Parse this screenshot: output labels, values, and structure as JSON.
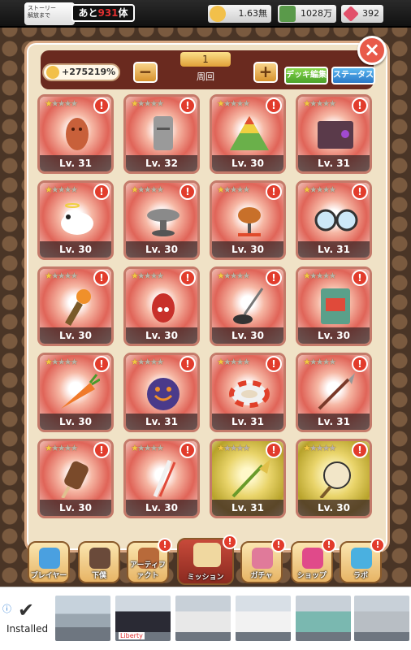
{
  "topbar": {
    "story_label": "ストーリー\n解放まで",
    "story_prefix": "あと",
    "story_count": "931",
    "story_suffix": "体",
    "coins": "1.63無",
    "medals": "1028万",
    "gems": "392"
  },
  "header": {
    "boost": "+275219%",
    "page_number": "1",
    "page_label": "周回",
    "minus": "−",
    "plus": "+",
    "deck_edit": "デッキ編集",
    "status": "ステータス"
  },
  "close_label": "×",
  "alert_mark": "!",
  "cards": [
    {
      "level": "Lv. 31",
      "stars": 1,
      "gold": false,
      "art": "clay-figure"
    },
    {
      "level": "Lv. 32",
      "stars": 1,
      "gold": false,
      "art": "moai"
    },
    {
      "level": "Lv. 30",
      "stars": 1,
      "gold": false,
      "art": "pyramid"
    },
    {
      "level": "Lv. 31",
      "stars": 1,
      "gold": false,
      "art": "book"
    },
    {
      "level": "Lv. 30",
      "stars": 1,
      "gold": false,
      "art": "panda"
    },
    {
      "level": "Lv. 30",
      "stars": 1,
      "gold": false,
      "art": "bowl"
    },
    {
      "level": "Lv. 30",
      "stars": 1,
      "gold": false,
      "art": "roast"
    },
    {
      "level": "Lv. 31",
      "stars": 1,
      "gold": false,
      "art": "glasses"
    },
    {
      "level": "Lv. 30",
      "stars": 1,
      "gold": false,
      "art": "torch"
    },
    {
      "level": "Lv. 30",
      "stars": 1,
      "gold": false,
      "art": "lantern"
    },
    {
      "level": "Lv. 30",
      "stars": 1,
      "gold": false,
      "art": "plunger"
    },
    {
      "level": "Lv. 30",
      "stars": 1,
      "gold": false,
      "art": "card"
    },
    {
      "level": "Lv. 30",
      "stars": 1,
      "gold": false,
      "art": "carrot"
    },
    {
      "level": "Lv. 31",
      "stars": 1,
      "gold": false,
      "art": "bomb"
    },
    {
      "level": "Lv. 31",
      "stars": 1,
      "gold": false,
      "art": "ring"
    },
    {
      "level": "Lv. 31",
      "stars": 1,
      "gold": false,
      "art": "spear"
    },
    {
      "level": "Lv. 30",
      "stars": 1,
      "gold": false,
      "art": "popsicle"
    },
    {
      "level": "Lv. 30",
      "stars": 1,
      "gold": false,
      "art": "chopsticks"
    },
    {
      "level": "Lv. 31",
      "stars": 1,
      "gold": true,
      "art": "broom"
    },
    {
      "level": "Lv. 30",
      "stars": 1,
      "gold": true,
      "art": "glove"
    }
  ],
  "nav": [
    {
      "label": "プレイヤー",
      "alert": false,
      "icon_color": "#4aa0e0"
    },
    {
      "label": "下僕",
      "alert": false,
      "icon_color": "#6a4a3a"
    },
    {
      "label": "アーティファクト",
      "alert": true,
      "icon_color": "#b86a3a"
    },
    {
      "label": "ミッション",
      "alert": true,
      "icon_color": "#f0d8a0"
    },
    {
      "label": "ガチャ",
      "alert": true,
      "icon_color": "#e07a9a"
    },
    {
      "label": "ショップ",
      "alert": true,
      "icon_color": "#e04a8a"
    },
    {
      "label": "ラボ",
      "alert": true,
      "icon_color": "#4ab0e0"
    }
  ],
  "ad": {
    "installed": "Installed",
    "car_brand": "Liberty"
  }
}
